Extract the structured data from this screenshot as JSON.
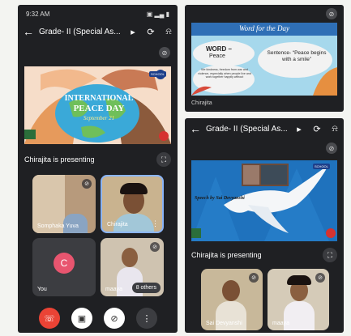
{
  "left_phone": {
    "status_time": "9:32 AM",
    "status_right": "▣ ▂▄ ▮",
    "meeting_title": "Grade- II (Special As...",
    "slide": {
      "heading": "INTERNATIONAL",
      "subheading": "PEACE DAY",
      "date": "September 21",
      "school_badge": "SCHOOL"
    },
    "presenting_text": "Chirajita is presenting",
    "tiles": [
      {
        "name": "Somphaka Yuva"
      },
      {
        "name": "Chirajita"
      },
      {
        "name": "You",
        "avatar_letter": "C"
      },
      {
        "name": "maaya",
        "others": "8 others"
      }
    ]
  },
  "right_top": {
    "slide": {
      "title": "Word for the Day",
      "word_label": "WORD –",
      "word": "Peace",
      "sentence_label": "Sentence- “Peace begins with a smile”",
      "meaning": "We kindness, freedom from war and violence, especially when people live and work together happily without",
      "presenter": "Chirajita"
    }
  },
  "right_bottom": {
    "meeting_title": "Grade- II (Special As...",
    "slide": {
      "caption": "Speech by Sai Devyanshi",
      "school_badge": "SCHOOL"
    },
    "presenting_text": "Chirajita is presenting",
    "tiles": [
      {
        "name": "Sai Devyanshi"
      },
      {
        "name": "maaya"
      }
    ]
  }
}
